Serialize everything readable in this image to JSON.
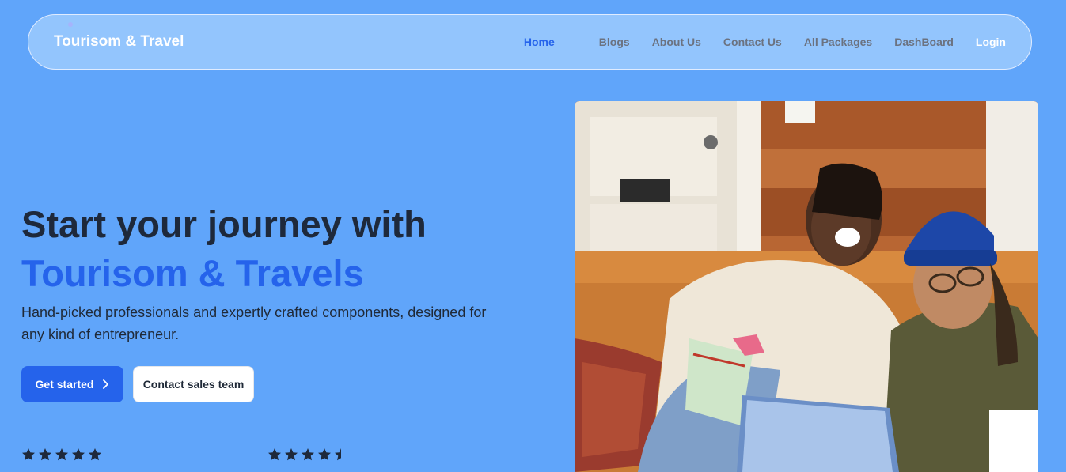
{
  "nav": {
    "brand": "Tourisom & Travel",
    "links": [
      {
        "label": "Home"
      },
      {
        "label": "Blogs"
      },
      {
        "label": "About Us"
      },
      {
        "label": "Contact Us"
      },
      {
        "label": "All Packages"
      },
      {
        "label": "DashBoard"
      },
      {
        "label": "Login"
      }
    ]
  },
  "hero": {
    "title_line1": "Start your journey with",
    "title_line2": "Tourisom & Travels",
    "description": "Hand-picked professionals and expertly crafted components, designed for any kind of entrepreneur.",
    "primary_button": "Get started",
    "secondary_button": "Contact sales team",
    "image_alt": "Two friends laughing on a couch with a laptop and gift bag"
  },
  "ratings": [
    {
      "value": 5,
      "max": 5
    },
    {
      "value": 4.5,
      "max": 5
    }
  ],
  "colors": {
    "background": "#60a5fa",
    "navbar": "#93c5fd",
    "accent": "#2563eb",
    "heading": "#1e293b",
    "star": "#1e293b"
  },
  "icons": {
    "button_chevron": "chevron-right-icon",
    "star": "star-icon"
  }
}
